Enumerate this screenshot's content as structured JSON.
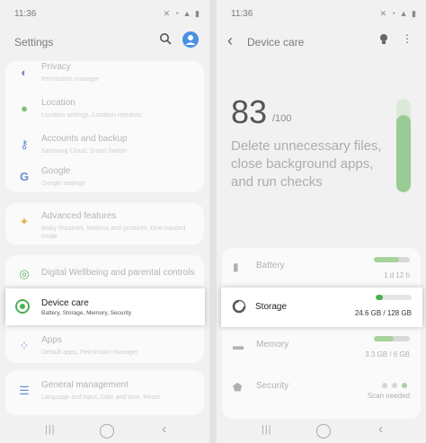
{
  "left": {
    "time": "11:36",
    "status_icons": "✕ ◔ ▲ ▮",
    "title": "Settings",
    "items": [
      {
        "title": "Privacy",
        "subtitle": "Permission manager"
      },
      {
        "title": "Location",
        "subtitle": "Location settings, Location requests"
      },
      {
        "title": "Accounts and backup",
        "subtitle": "Samsung Cloud, Smart Switch"
      },
      {
        "title": "Google",
        "subtitle": "Google settings"
      },
      {
        "title": "Advanced features",
        "subtitle": "Bixby Routines, Motions and gestures, One-handed mode"
      },
      {
        "title": "Digital Wellbeing and parental controls",
        "subtitle": ""
      },
      {
        "title": "Device care",
        "subtitle": "Battery, Storage, Memory, Security"
      },
      {
        "title": "Apps",
        "subtitle": "Default apps, Permission manager"
      },
      {
        "title": "General management",
        "subtitle": "Language and input, Date and time, Reset"
      }
    ],
    "nav": {
      "recent": "|||",
      "home": "◯",
      "back": "‹"
    }
  },
  "right": {
    "time": "11:36",
    "status_icons": "✕ ◔ ▲ ▮",
    "title": "Device care",
    "back_arrow": "‹",
    "score": "83",
    "score_max": "/100",
    "score_fraction": 0.83,
    "description": "Delete unnecessary files, close background apps, and run checks",
    "rows": [
      {
        "label": "Battery",
        "value": "1 d 12 h",
        "fraction": 0.7
      },
      {
        "label": "Storage",
        "value": "24.6 GB / 128 GB",
        "fraction": 0.19
      },
      {
        "label": "Memory",
        "value": "3.3 GB / 6 GB",
        "fraction": 0.55
      },
      {
        "label": "Security",
        "value": "Scan needed",
        "fraction": 0
      }
    ],
    "nav": {
      "recent": "|||",
      "home": "◯",
      "back": "‹"
    }
  },
  "colors": {
    "accent_green": "#4caf50",
    "avatar_blue": "#4a90e2",
    "score_bar": "#9acb95"
  }
}
